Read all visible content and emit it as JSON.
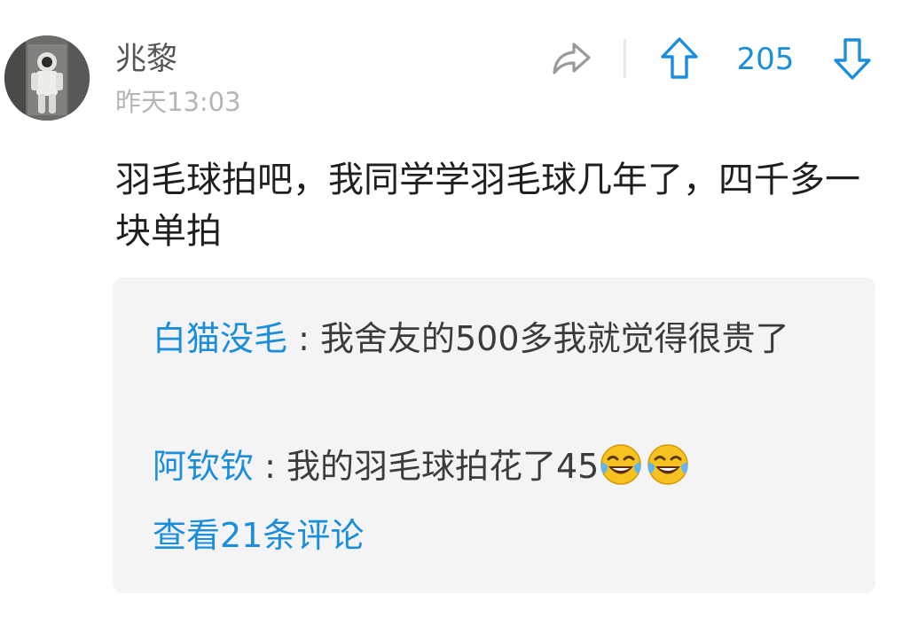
{
  "comment": {
    "username": "兆黎",
    "time": "昨天13:03",
    "text": "羽毛球拍吧，我同学学羽毛球几年了，四千多一块单拍",
    "vote_count": "205",
    "icons": {
      "share": "share-arrow-icon",
      "upvote": "arrow-up-icon",
      "downvote": "arrow-down-icon"
    }
  },
  "replies": [
    {
      "author": "白猫没毛",
      "separator": " : ",
      "text": "我舍友的500多我就觉得很贵了"
    },
    {
      "author": "阿钦钦",
      "separator": " : ",
      "text": "我的羽毛球拍花了45",
      "emojis": [
        "laughing-tears-emoji",
        "laughing-tears-emoji"
      ]
    }
  ],
  "view_all_label": "查看21条评论",
  "colors": {
    "accent": "#1a8ddb",
    "username": "#555555",
    "timestamp": "#b5b5b5",
    "body_text": "#1f1f1f",
    "reply_background": "#f4f4f6"
  }
}
